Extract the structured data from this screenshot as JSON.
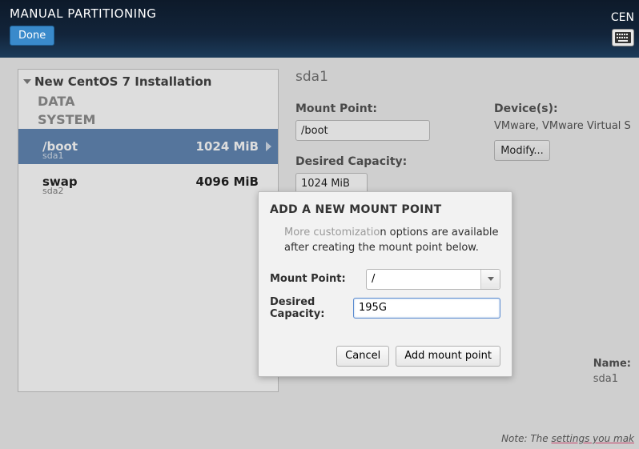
{
  "header": {
    "title": "MANUAL PARTITIONING",
    "done_label": "Done",
    "right_label": "CEN"
  },
  "left": {
    "install_title": "New CentOS 7 Installation",
    "section_data": "DATA",
    "section_system": "SYSTEM",
    "partitions": [
      {
        "name": "/boot",
        "device": "sda1",
        "size": "1024 MiB",
        "selected": true
      },
      {
        "name": "swap",
        "device": "sda2",
        "size": "4096 MiB",
        "selected": false
      }
    ]
  },
  "right": {
    "device_title": "sda1",
    "mount_label": "Mount Point:",
    "mount_value": "/boot",
    "capacity_label": "Desired Capacity:",
    "capacity_value": "1024 MiB",
    "devices_label": "Device(s):",
    "devices_value": "VMware, VMware Virtual S",
    "modify_label": "Modify...",
    "name_label": "Name:",
    "name_value": "sda1",
    "note_prefix": "Note:  The ",
    "note_underlined": "settings you mak"
  },
  "dialog": {
    "title": "ADD A NEW MOUNT POINT",
    "msg_light": "More customizatio",
    "msg_rest": "n options are available after creating the mount point below.",
    "mount_label": "Mount Point:",
    "mount_value": "/",
    "capacity_label": "Desired Capacity:",
    "capacity_value": "195G",
    "cancel_label": "Cancel",
    "add_label": "Add mount point"
  }
}
